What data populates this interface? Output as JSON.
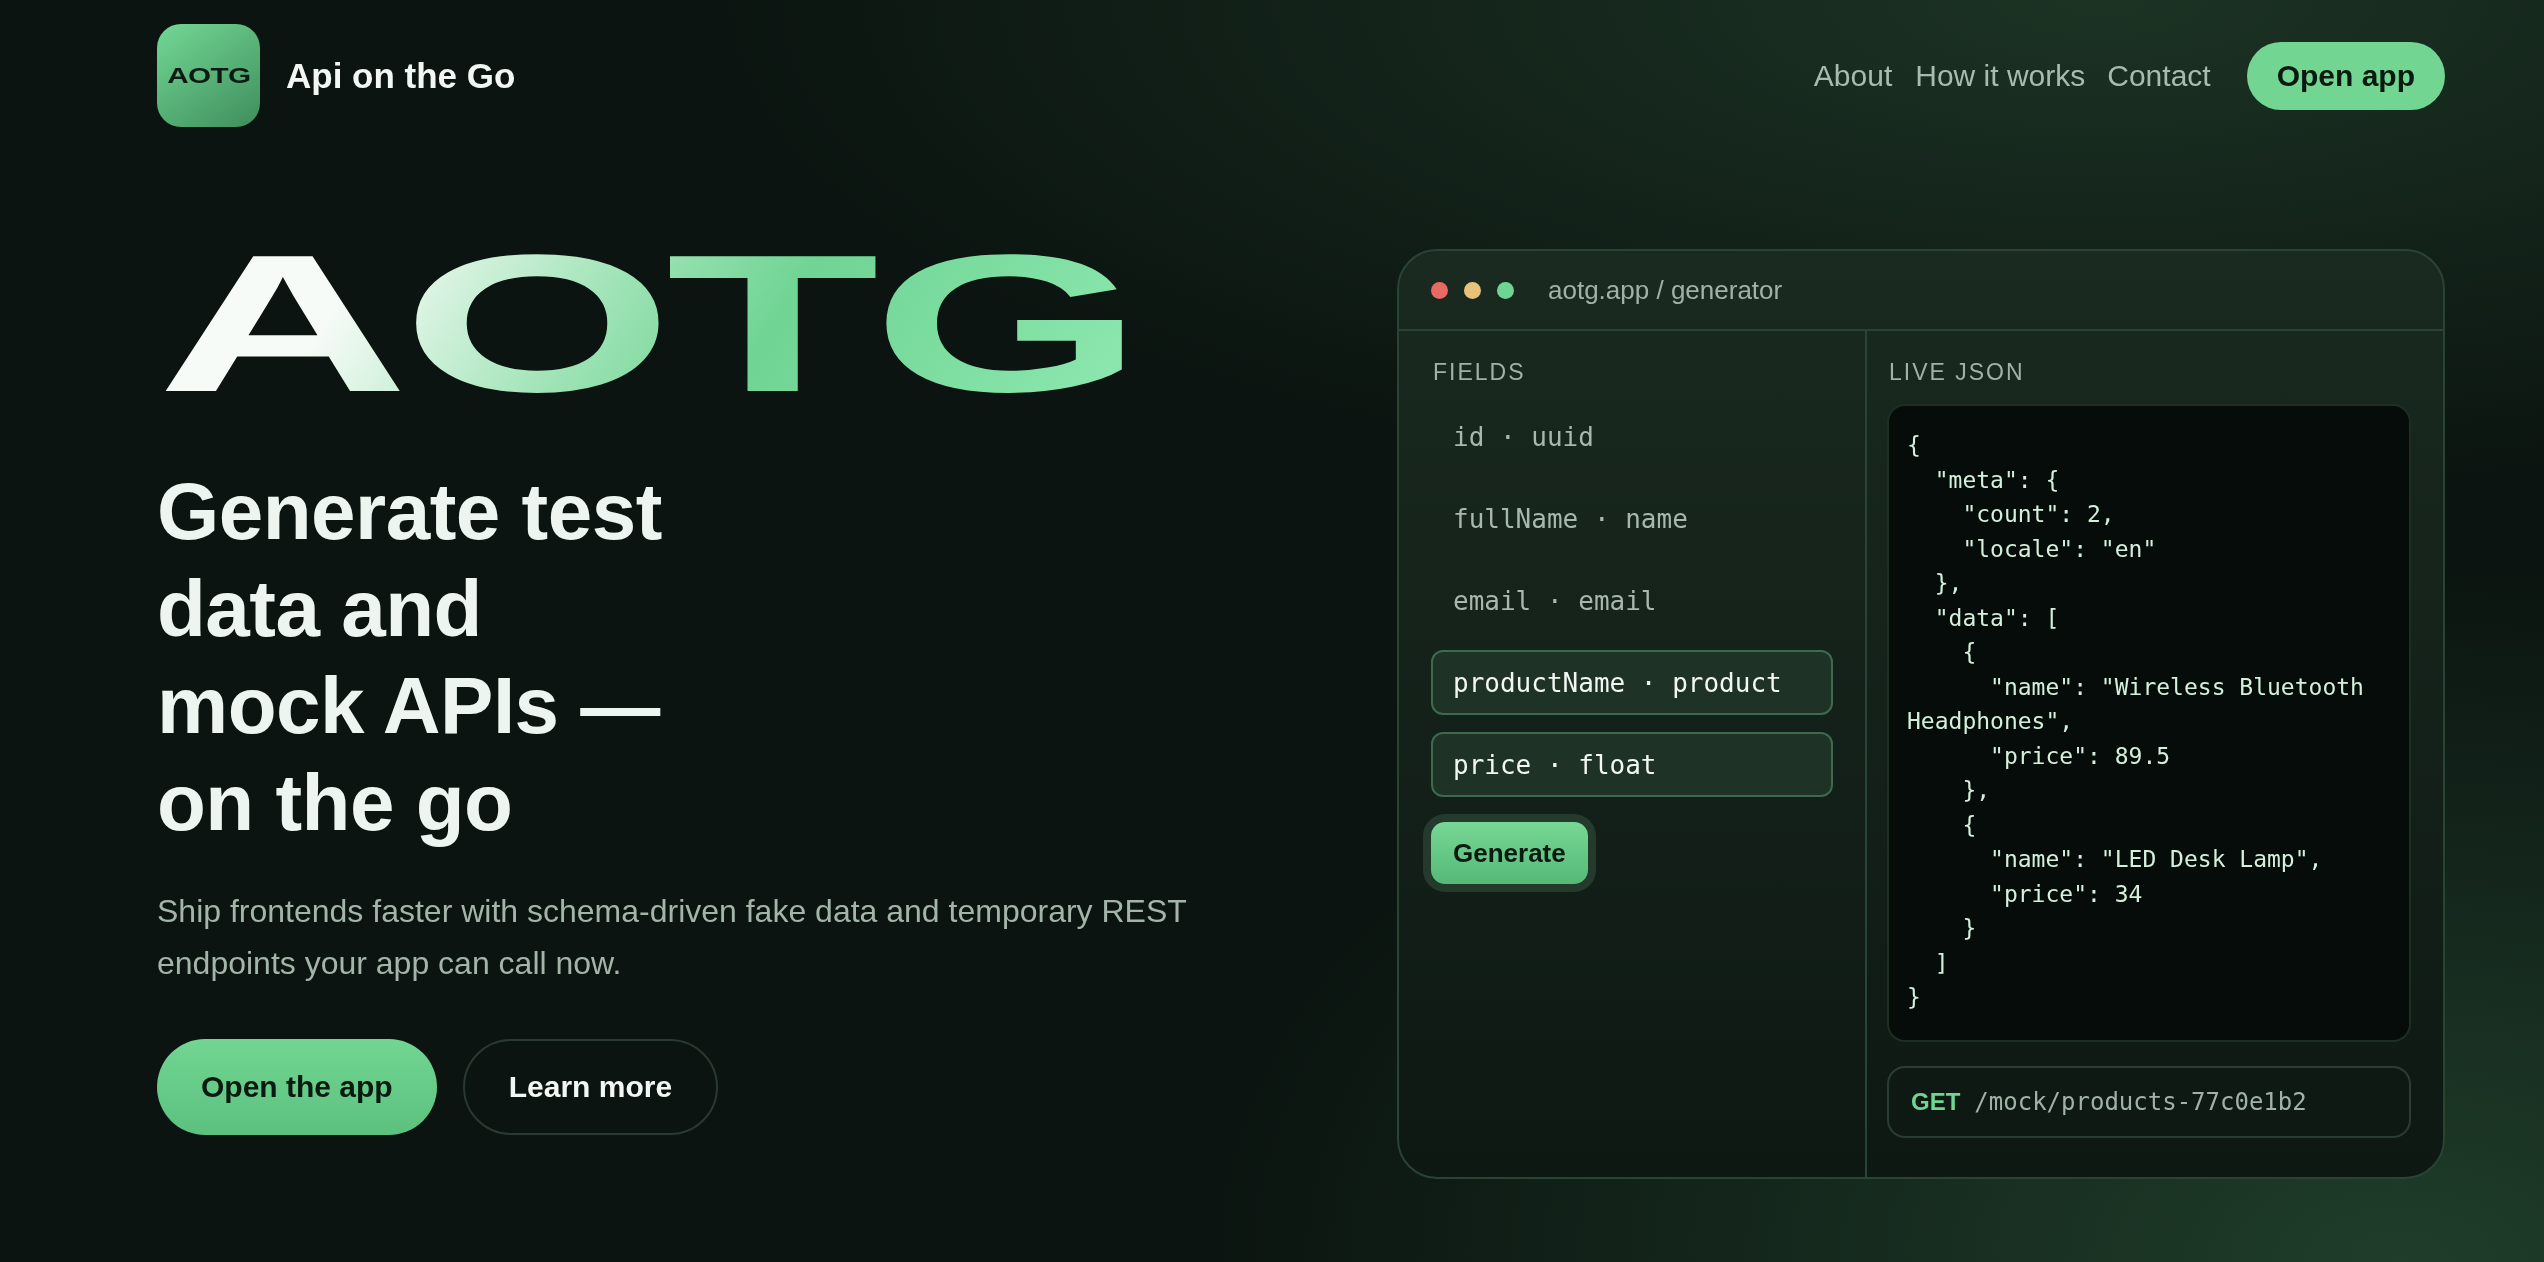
{
  "brand": {
    "logo_text": "AOTG",
    "name": "Api on the Go"
  },
  "nav": {
    "links": [
      "About",
      "How it works",
      "Contact"
    ],
    "cta": "Open app"
  },
  "hero": {
    "wordmark": "AOTG",
    "headline_lines": [
      "Generate test",
      "data and",
      "mock APIs —",
      "on the go"
    ],
    "subtitle": "Ship frontends faster with schema-driven fake data and temporary REST endpoints your app can call now.",
    "buttons": [
      {
        "label": "Open the app",
        "kind": "primary"
      },
      {
        "label": "Learn more",
        "kind": "secondary"
      }
    ]
  },
  "generator": {
    "title": "aotg.app / generator",
    "fields_label": "FIELDS",
    "fields": [
      {
        "text": "id · uuid",
        "selected": false
      },
      {
        "text": "fullName · name",
        "selected": false
      },
      {
        "text": "email · email",
        "selected": false
      },
      {
        "text": "productName · product",
        "selected": true
      },
      {
        "text": "price · float",
        "selected": true
      }
    ],
    "generate_button": "Generate",
    "json_label": "LIVE JSON",
    "json_lines": [
      "{",
      "  \"meta\": {",
      "    \"count\": 2,",
      "    \"locale\": \"en\"",
      "  },",
      "  \"data\": [",
      "    {",
      "      \"name\": \"Wireless Bluetooth",
      "Headphones\",",
      "      \"price\": 89.5",
      "    },",
      "    {",
      "      \"name\": \"LED Desk Lamp\",",
      "      \"price\": 34",
      "    }",
      "  ]",
      "}"
    ],
    "endpoint": {
      "method": "GET",
      "path": "/mock/products-77c0e1b2"
    }
  }
}
